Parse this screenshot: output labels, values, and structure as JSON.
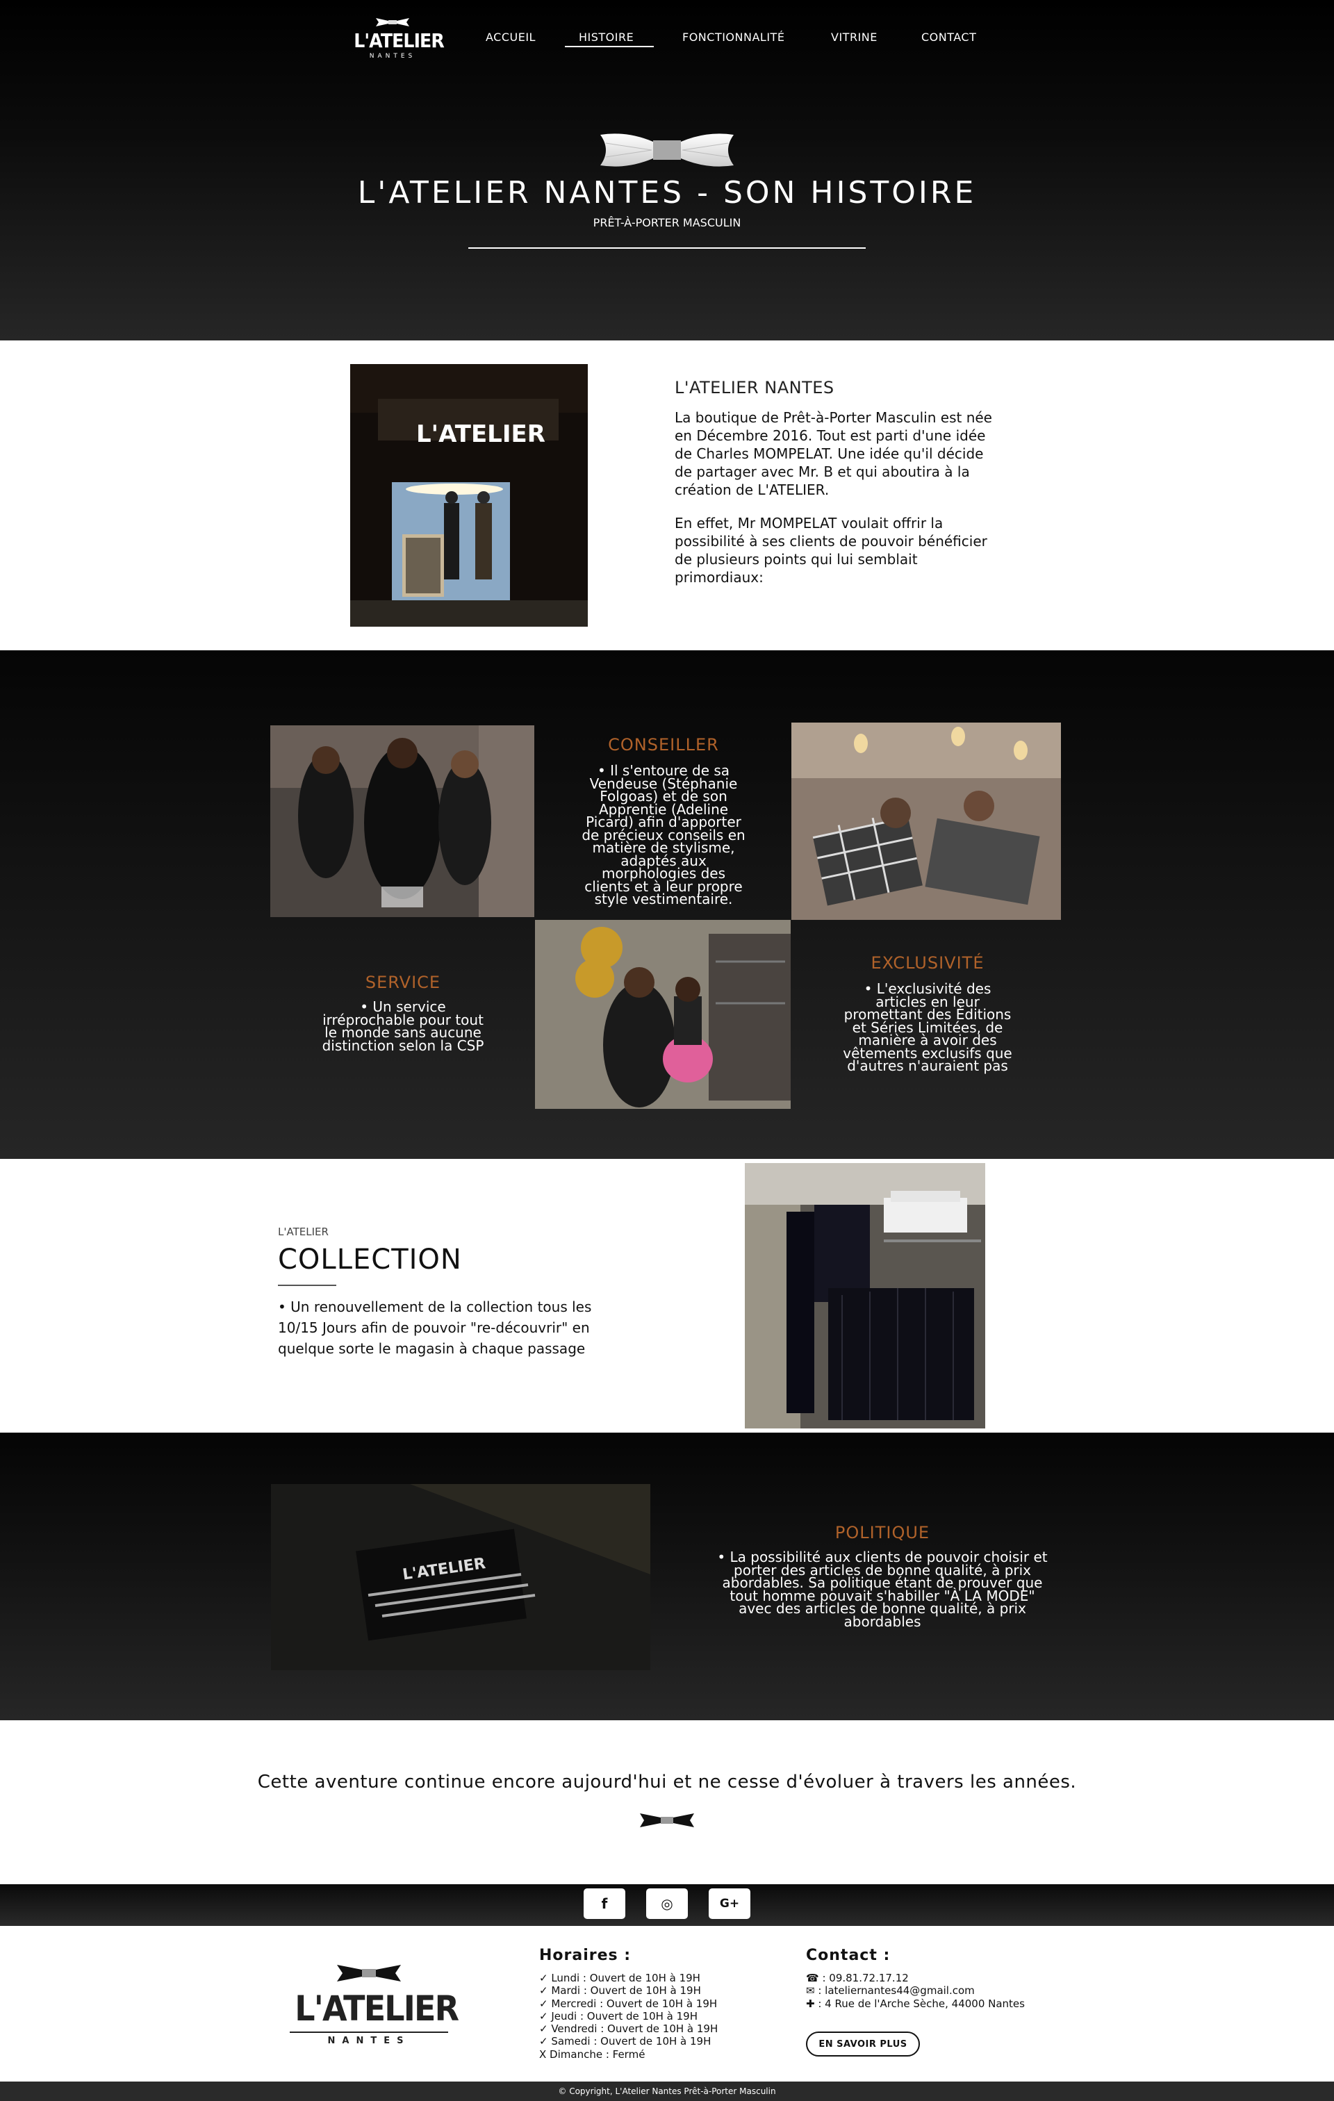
{
  "header": {
    "logo": {
      "word": "L'ATELIER",
      "sub": "NANTES"
    },
    "nav": [
      {
        "label": "ACCUEIL"
      },
      {
        "label": "HISTOIRE"
      },
      {
        "label": "FONCTIONNALITÉ"
      },
      {
        "label": "VITRINE"
      },
      {
        "label": "CONTACT"
      }
    ],
    "active_nav": "HISTOIRE",
    "title": "L'ATELIER NANTES - SON HISTOIRE",
    "subtitle": "PRÊT-À-PORTER MASCULIN"
  },
  "about": {
    "title": "L'ATELIER NANTES",
    "paragraph1": [
      "La boutique de Prêt-à-Porter Masculin est née",
      "en Décembre 2016. Tout est parti d'une idée",
      "de Charles MOMPELAT. Une idée qu'il décide",
      "de partager avec Mr. B et qui aboutira à la",
      "création de L'ATELIER."
    ],
    "paragraph2": [
      "En effet, Mr MOMPELAT voulait offrir la",
      "possibilité à ses clients de pouvoir bénéficier",
      "de plusieurs points qui lui semblait",
      "primordiaux:"
    ],
    "image_sign_text": "L'ATELIER"
  },
  "values": {
    "conseiller": {
      "title": "CONSEILLER",
      "lines": [
        "• Il s'entoure de sa",
        "Vendeuse (Stéphanie",
        "Folgoas) et de son",
        "Apprentie (Adeline",
        "Picard) afin d'apporter",
        "de précieux conseils en",
        "matière de stylisme,",
        "adaptés aux",
        "morphologies des",
        "clients et à leur propre",
        "style vestimentaire."
      ]
    },
    "service": {
      "title": "SERVICE",
      "lines": [
        "• Un service",
        "irréprochable pour tout",
        "le monde sans aucune",
        "distinction selon la CSP"
      ]
    },
    "exclusivite": {
      "title": "EXCLUSIVITÉ",
      "lines": [
        "• L'exclusivité des",
        "articles en leur",
        "promettant des Éditions",
        "et Séries Limitées, de",
        "manière à avoir des",
        "vêtements exclusifs que",
        "d'autres n'auraient pas"
      ]
    }
  },
  "collection": {
    "kicker": "L'ATELIER",
    "title": "COLLECTION",
    "lines": [
      "• Un renouvellement de la collection tous les",
      "10/15 Jours afin de pouvoir \"re-découvrir\" en",
      "quelque sorte le magasin à chaque passage"
    ]
  },
  "politique": {
    "title": "POLITIQUE",
    "lines": [
      "• La possibilité aux clients de pouvoir choisir et",
      "porter des articles de bonne qualité, à prix",
      "abordables. Sa politique étant de prouver que",
      "tout homme pouvait s'habiller \"À LA MODE\"",
      "avec des articles de bonne qualité, à prix",
      "abordables"
    ],
    "card_text": "L'ATELIER"
  },
  "conclusion": "Cette aventure continue encore aujourd'hui et ne cesse d'évoluer à travers les années.",
  "social": [
    {
      "icon": "facebook-icon",
      "glyph": "f"
    },
    {
      "icon": "instagram-icon",
      "glyph": "◎"
    },
    {
      "icon": "google-plus-icon",
      "glyph": "G+"
    }
  ],
  "footer": {
    "logo": {
      "word": "L'ATELIER",
      "sub": "NANTES"
    },
    "horaires_title": "Horaires :",
    "horaires": [
      "✓ Lundi : Ouvert de 10H à 19H",
      "✓ Mardi : Ouvert de 10H à 19H",
      "✓ Mercredi : Ouvert de 10H à 19H",
      "✓ Jeudi : Ouvert de 10H à 19H",
      "✓ Vendredi : Ouvert de 10H à 19H",
      "✓ Samedi : Ouvert de 10H à 19H",
      "X Dimanche : Fermé"
    ],
    "contact_title": "Contact :",
    "contact": [
      "☎ : 09.81.72.17.12",
      "✉ : lateliernantes44@gmail.com",
      "✚ : 4 Rue de l'Arche Sèche, 44000 Nantes"
    ],
    "button": "EN SAVOIR PLUS",
    "copyright": "© Copyright, L'Atelier Nantes Prêt-à-Porter Masculin"
  }
}
